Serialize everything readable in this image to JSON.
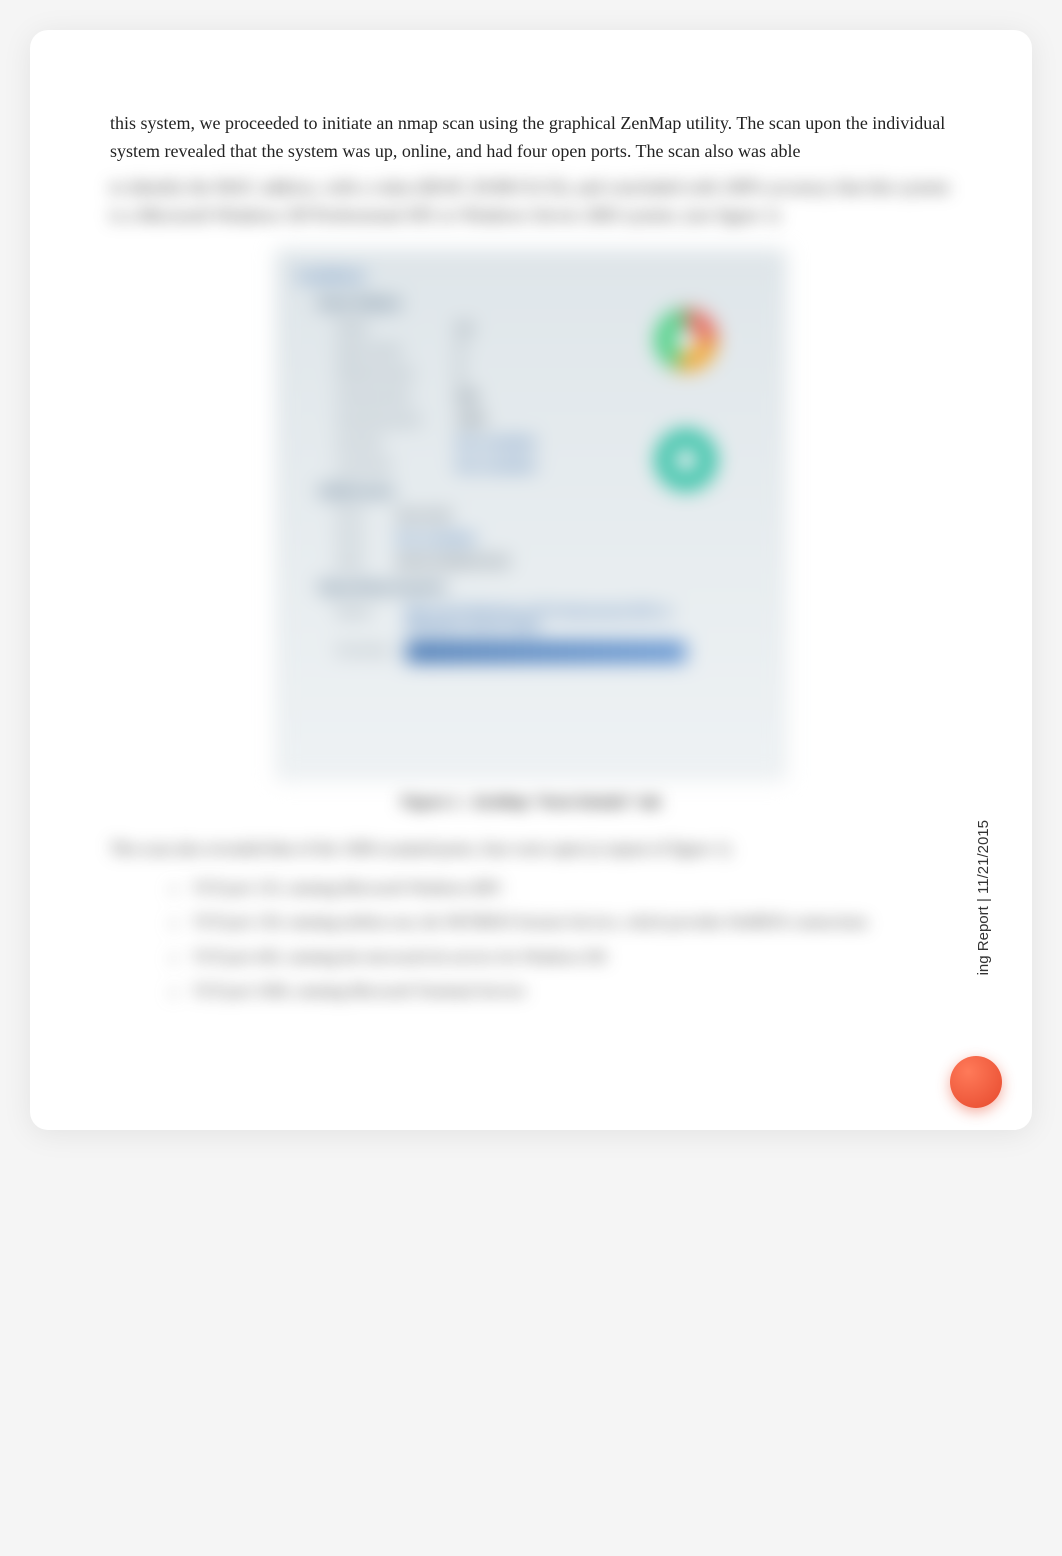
{
  "paragraph": {
    "visible": "this system, we proceeded to initiate an nmap scan using the graphical ZenMap utility.   The scan upon the individual system revealed that the system was up, online, and had four open ports.  The scan also was able",
    "blurred": "to identify the MAC address, with a value (00:0C:29:88:C6:33), and concluded with 100% accuracy that this system is a Microsoft Windows XP Professional SP2 or Windows Server 2003 system.    (see figure 1)"
  },
  "scan": {
    "top_label": "localhost",
    "host_status": {
      "title": "Host Status",
      "rows": [
        {
          "label": "State:",
          "value": "up"
        },
        {
          "label": "Open ports:",
          "value": "4"
        },
        {
          "label": "Filtered ports:",
          "value": "0"
        },
        {
          "label": "Closed ports:",
          "value": "996"
        },
        {
          "label": "Scanned ports:",
          "value": "1000"
        },
        {
          "label": "Up time:",
          "value": "Not available"
        },
        {
          "label": "Last boot:",
          "value": "Not available"
        }
      ]
    },
    "addresses": {
      "title": "Addresses",
      "rows": [
        {
          "label": "IPv4:",
          "value": "10.1.0.10"
        },
        {
          "label": "IPv6:",
          "value": "Not available"
        },
        {
          "label": "MAC:",
          "value": "00:0C:29:88:C6:33"
        }
      ]
    },
    "os": {
      "title": "Operating System",
      "name_label": "Name:",
      "name_value": "Microsoft Windows XP Professional SP2 or Windows Server 2003",
      "accuracy_label": "Accuracy:"
    }
  },
  "figure_caption": "Figure 1 - ZenMap \"Host Details\" tab",
  "summary": "The scan also revealed that of the 1000 scanned ports, four were open  (a repeat of figure 1).",
  "bullets": [
    "TCP port 135, running Microsoft Windows RPC",
    "TCP port 139, running netbios-ssn, the NETBIOS Session Service, which provides NetBIOS connections",
    "TCP port 445, running the microsoft-ds service for Windows DS",
    "TCP port 3306, running Microsoft Terminal Service"
  ],
  "side_label": "ing Report |  11/21/2015",
  "markers": [
    "a",
    "a",
    "a",
    "a"
  ]
}
